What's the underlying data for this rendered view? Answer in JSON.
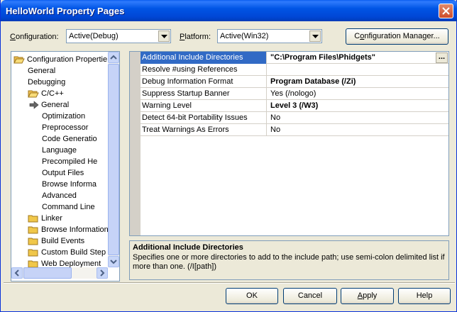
{
  "window": {
    "title": "HelloWorld Property Pages"
  },
  "config": {
    "configuration_label_pre": "",
    "configuration_label_ul": "C",
    "configuration_label_post": "onfiguration:",
    "configuration_value": "Active(Debug)",
    "platform_label_ul": "P",
    "platform_label_post": "latform:",
    "platform_value": "Active(Win32)",
    "manager_label_pre": "C",
    "manager_label_ul": "o",
    "manager_label_post": "nfiguration Manager..."
  },
  "tree": {
    "items": [
      {
        "label": "Configuration Propertie",
        "icon": "open-folder-icon",
        "expand": "minus"
      },
      {
        "label": "General"
      },
      {
        "label": "Debugging"
      },
      {
        "label": "C/C++",
        "icon": "open-folder-icon",
        "expand": "minus"
      },
      {
        "label": "General",
        "icon": "arrow-icon"
      },
      {
        "label": "Optimization"
      },
      {
        "label": "Preprocessor"
      },
      {
        "label": "Code Generatio"
      },
      {
        "label": "Language"
      },
      {
        "label": "Precompiled He"
      },
      {
        "label": "Output Files"
      },
      {
        "label": "Browse Informa"
      },
      {
        "label": "Advanced"
      },
      {
        "label": "Command Line"
      },
      {
        "label": "Linker",
        "icon": "folder-icon"
      },
      {
        "label": "Browse Information",
        "icon": "folder-icon"
      },
      {
        "label": "Build Events",
        "icon": "folder-icon"
      },
      {
        "label": "Custom Build Step",
        "icon": "folder-icon"
      },
      {
        "label": "Web Deployment",
        "icon": "folder-icon"
      }
    ]
  },
  "grid": {
    "rows": [
      {
        "name": "Additional Include Directories",
        "value": "\"C:\\Program Files\\Phidgets\"",
        "bold": true,
        "selected": true
      },
      {
        "name": "Resolve #using References",
        "value": ""
      },
      {
        "name": "Debug Information Format",
        "value": "Program Database (/Zi)",
        "bold": true
      },
      {
        "name": "Suppress Startup Banner",
        "value": "Yes (/nologo)"
      },
      {
        "name": "Warning Level",
        "value": "Level 3 (/W3)",
        "bold": true
      },
      {
        "name": "Detect 64-bit Portability Issues",
        "value": "No"
      },
      {
        "name": "Treat Warnings As Errors",
        "value": "No"
      }
    ],
    "ellipsis": "..."
  },
  "description": {
    "title": "Additional Include Directories",
    "text": "Specifies one or more directories to add to the include path; use semi-colon delimited list if more than one.     (/I[path])"
  },
  "buttons": {
    "ok": "OK",
    "cancel": "Cancel",
    "apply_ul": "A",
    "apply_post": "pply",
    "help": "Help"
  },
  "colors": {
    "titlebar": "#0055e5",
    "selection": "#316ac5",
    "dialog_bg": "#ece9d8"
  }
}
